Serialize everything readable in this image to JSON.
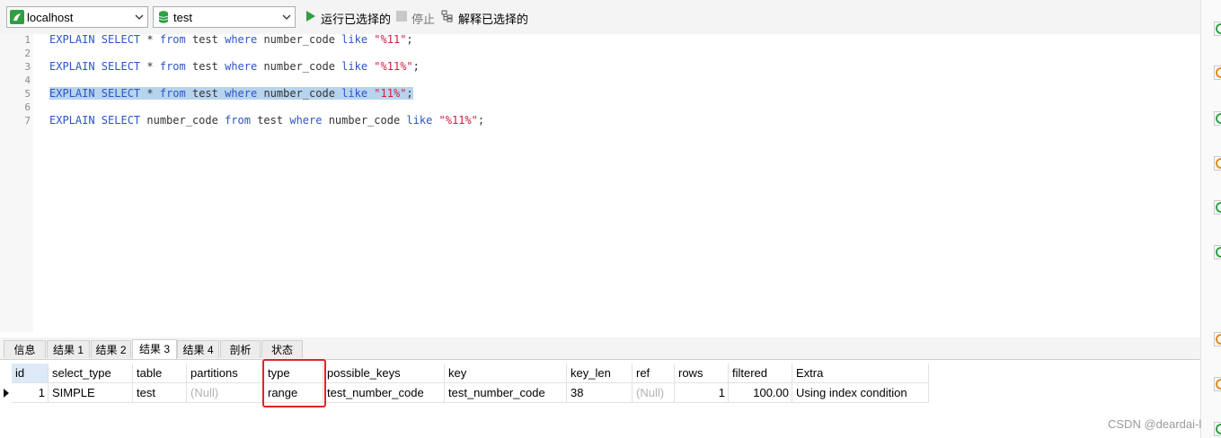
{
  "toolbar": {
    "connection": "localhost",
    "database": "test",
    "run_selected_label": "运行已选择的",
    "stop_label": "停止",
    "explain_selected_label": "解释已选择的",
    "run_color": "#2ea043"
  },
  "editor": {
    "line_numbers": [
      "1",
      "2",
      "3",
      "4",
      "5",
      "6",
      "7"
    ],
    "lines": [
      {
        "tokens": [
          {
            "t": "EXPLAIN SELECT",
            "c": "k"
          },
          {
            "t": " * ",
            "c": ""
          },
          {
            "t": "from",
            "c": "k"
          },
          {
            "t": " test ",
            "c": ""
          },
          {
            "t": "where",
            "c": "k"
          },
          {
            "t": " number_code ",
            "c": ""
          },
          {
            "t": "like",
            "c": "k"
          },
          {
            "t": " ",
            "c": ""
          },
          {
            "t": "\"%11\"",
            "c": "s"
          },
          {
            "t": ";",
            "c": ""
          }
        ]
      },
      {
        "tokens": []
      },
      {
        "tokens": [
          {
            "t": "EXPLAIN SELECT",
            "c": "k"
          },
          {
            "t": " * ",
            "c": ""
          },
          {
            "t": "from",
            "c": "k"
          },
          {
            "t": " test ",
            "c": ""
          },
          {
            "t": "where",
            "c": "k"
          },
          {
            "t": " number_code ",
            "c": ""
          },
          {
            "t": "like",
            "c": "k"
          },
          {
            "t": " ",
            "c": ""
          },
          {
            "t": "\"%11%\"",
            "c": "s"
          },
          {
            "t": ";",
            "c": ""
          }
        ]
      },
      {
        "tokens": []
      },
      {
        "selected": true,
        "tokens": [
          {
            "t": "EXPLAIN SELECT",
            "c": "k"
          },
          {
            "t": " * ",
            "c": ""
          },
          {
            "t": "from",
            "c": "k"
          },
          {
            "t": " test ",
            "c": ""
          },
          {
            "t": "where",
            "c": "k"
          },
          {
            "t": " number_code ",
            "c": ""
          },
          {
            "t": "like",
            "c": "k"
          },
          {
            "t": " ",
            "c": ""
          },
          {
            "t": "\"11%\"",
            "c": "s"
          },
          {
            "t": ";",
            "c": ""
          }
        ]
      },
      {
        "tokens": []
      },
      {
        "tokens": [
          {
            "t": "EXPLAIN SELECT",
            "c": "k"
          },
          {
            "t": " number_code ",
            "c": ""
          },
          {
            "t": "from",
            "c": "k"
          },
          {
            "t": " test ",
            "c": ""
          },
          {
            "t": "where",
            "c": "k"
          },
          {
            "t": " number_code ",
            "c": ""
          },
          {
            "t": "like",
            "c": "k"
          },
          {
            "t": " ",
            "c": ""
          },
          {
            "t": "\"%11%\"",
            "c": "s"
          },
          {
            "t": ";",
            "c": ""
          }
        ]
      }
    ],
    "selection_color": "#b7d4ee"
  },
  "result_tabs": [
    "信息",
    "结果 1",
    "结果 2",
    "结果 3",
    "结果 4",
    "剖析",
    "状态"
  ],
  "active_tab": "结果 3",
  "table": {
    "columns": [
      "id",
      "select_type",
      "table",
      "partitions",
      "type",
      "possible_keys",
      "key",
      "key_len",
      "ref",
      "rows",
      "filtered",
      "Extra"
    ],
    "row": [
      "1",
      "SIMPLE",
      "test",
      "(Null)",
      "range",
      "test_number_code",
      "test_number_code",
      "38",
      "(Null)",
      "1",
      "100.00",
      "Using index condition"
    ]
  },
  "highlight_color": "#e02424",
  "watermark": "CSDN @deardai-l"
}
